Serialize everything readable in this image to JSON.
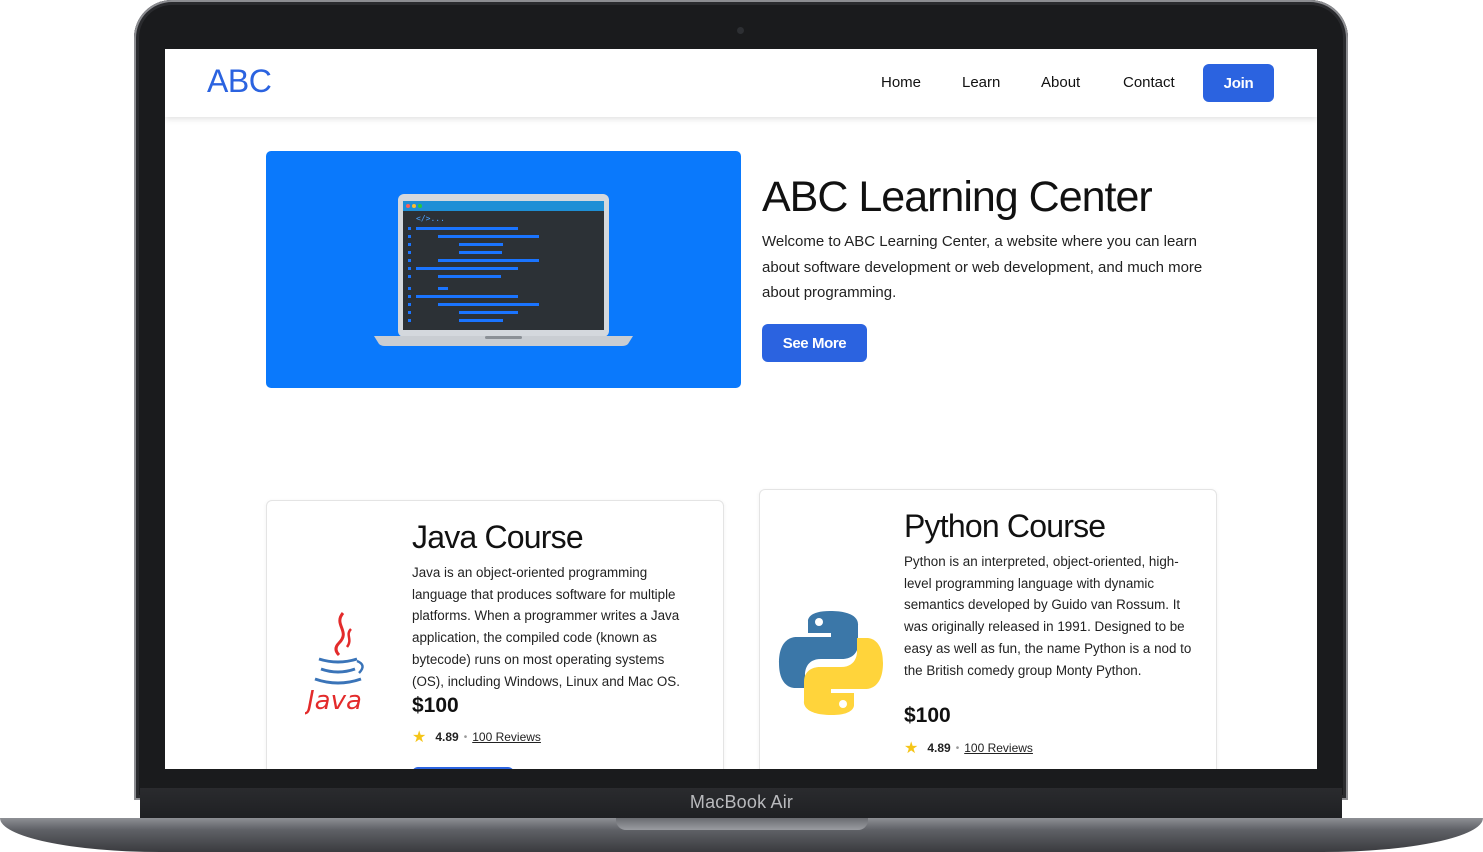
{
  "device": {
    "label": "MacBook Air"
  },
  "navbar": {
    "brand": "ABC",
    "links": [
      "Home",
      "Learn",
      "About",
      "Contact"
    ],
    "join_label": "Join"
  },
  "hero": {
    "title": "ABC Learning Center",
    "description": "Welcome to ABC Learning Center, a website where you can learn about software development or web development, and much more about programming.",
    "button_label": "See More",
    "image_code_tag": "</>..."
  },
  "courses": [
    {
      "title": "Java Course",
      "description": "Java is an object-oriented programming language that produces software for multiple platforms. When a programmer writes a Java application, the compiled code (known as bytecode) runs on most operating systems (OS), including Windows, Linux and Mac OS.",
      "price": "$100",
      "rating": "4.89",
      "reviews": "100 Reviews",
      "logo_text": "Java"
    },
    {
      "title": "Python Course",
      "description": "Python is an interpreted, object-oriented, high-level programming language with dynamic semantics developed by Guido van Rossum. It was originally released in 1991. Designed to be easy as well as fun, the name Python is a nod to the British comedy group Monty Python.",
      "price": "$100",
      "rating": "4.89",
      "reviews": "100 Reviews"
    }
  ],
  "icons": {
    "rating": "star-icon",
    "java_logo": "java-logo-icon",
    "python_logo": "python-logo-icon",
    "hero_image": "laptop-code-illustration"
  },
  "colors": {
    "accent": "#2b63e0",
    "hero_bg": "#0a79fc",
    "star": "#f5c518"
  }
}
